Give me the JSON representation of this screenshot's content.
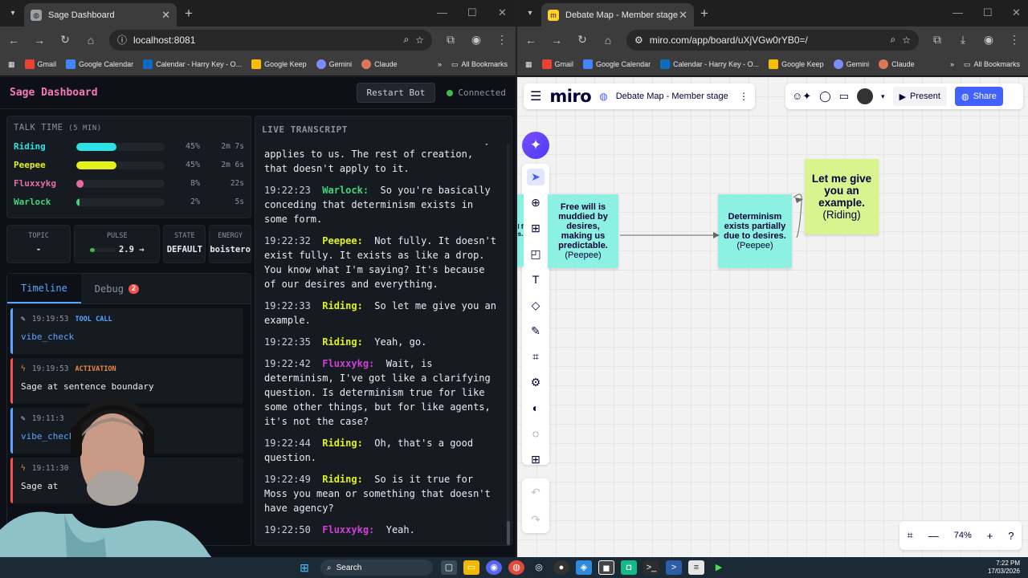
{
  "left_window": {
    "tab_title": "Sage Dashboard",
    "url": "localhost:8081",
    "bookmarks": [
      "Gmail",
      "Google Calendar",
      "Calendar - Harry Key - O...",
      "Google Keep",
      "Gemini",
      "Claude"
    ],
    "all_bookmarks": "All Bookmarks"
  },
  "right_window": {
    "tab_title": "Debate Map - Member stage - Miro",
    "url": "miro.com/app/board/uXjVGw0rYB0=/",
    "bookmarks": [
      "Gmail",
      "Google Calendar",
      "Calendar - Harry Key - O...",
      "Google Keep",
      "Gemini",
      "Claude"
    ],
    "all_bookmarks": "All Bookmarks"
  },
  "sage": {
    "title": "Sage Dashboard",
    "restart_label": "Restart Bot",
    "status": "Connected",
    "talk_time": {
      "heading": "TALK TIME",
      "window": "(5 MIN)",
      "rows": [
        {
          "name": "Riding",
          "pct": "45%",
          "time": "2m 7s",
          "fraction": 0.45,
          "color": "#2de2e6"
        },
        {
          "name": "Peepee",
          "pct": "45%",
          "time": "2m 6s",
          "fraction": 0.45,
          "color": "#e3f21c"
        },
        {
          "name": "Fluxxykg",
          "pct": "8%",
          "time": "22s",
          "fraction": 0.08,
          "color": "#e06fa0"
        },
        {
          "name": "Warlock",
          "pct": "2%",
          "time": "5s",
          "fraction": 0.02,
          "color": "#3fd67a"
        }
      ]
    },
    "stats": {
      "topic_label": "TOPIC",
      "topic_value": "-",
      "pulse_label": "PULSE",
      "pulse_value": "2.9 →",
      "state_label": "STATE",
      "state_value": "DEFAULT",
      "energy_label": "ENERGY",
      "energy_value": "boistero"
    },
    "tabs": {
      "timeline": "Timeline",
      "debug": "Debug",
      "debug_count": "2"
    },
    "events": [
      {
        "time": "19:19:53",
        "kind": "TOOL CALL",
        "body": "vibe_check",
        "type": "tool"
      },
      {
        "time": "19:19:53",
        "kind": "ACTIVATION",
        "body": "Sage at sentence boundary",
        "type": "act"
      },
      {
        "time": "19:11:3",
        "kind": "",
        "body": "vibe_check",
        "type": "tool"
      },
      {
        "time": "19:11:30",
        "kind": "",
        "body": "Sage at",
        "type": "act"
      }
    ],
    "transcript_heading": "LIVE TRANSCRIPT",
    "transcript_top": "to the universe itself. I think it only applies to us. The rest of creation, that doesn't apply to it.",
    "transcript": [
      {
        "time": "19:22:23",
        "speaker": "Warlock:",
        "text": "So you're basically conceding that determinism exists in some form.",
        "color": "#3fd67a"
      },
      {
        "time": "19:22:32",
        "speaker": "Peepee:",
        "text": "Not fully. It doesn't exist fully. It exists as like a drop. You know what I'm saying? It's because of our desires and everything.",
        "color": "#e3f21c"
      },
      {
        "time": "19:22:33",
        "speaker": "Riding:",
        "text": "So let me give you an example.",
        "color": "#e3f21c"
      },
      {
        "time": "19:22:35",
        "speaker": "Riding:",
        "text": "Yeah, go.",
        "color": "#e3f21c"
      },
      {
        "time": "19:22:42",
        "speaker": "Fluxxykg:",
        "text": "Wait, is determinism, I've got like a clarifying question. Is determinism true for like some other things, but for like agents, it's not the case?",
        "color": "#d23fd6"
      },
      {
        "time": "19:22:44",
        "speaker": "Riding:",
        "text": "Oh, that's a good question.",
        "color": "#e3f21c"
      },
      {
        "time": "19:22:49",
        "speaker": "Riding:",
        "text": "So is it true for Moss you mean or something that doesn't have agency?",
        "color": "#e3f21c"
      },
      {
        "time": "19:22:50",
        "speaker": "Fluxxykg:",
        "text": "Yeah.",
        "color": "#d23fd6"
      }
    ]
  },
  "miro": {
    "logo": "miro",
    "board_name": "Debate Map - Member stage",
    "present_label": "Present",
    "share_label": "Share",
    "zoom": "74%",
    "stickies": [
      {
        "text": "Free will is muddied by desires, making us predictable.",
        "author": "(Peepee)",
        "color": "#8cf0e2"
      },
      {
        "text": "Determinism exists partially due to desires.",
        "author": "(Peepee)",
        "color": "#8cf0e2"
      },
      {
        "text": "Let me give you an example.",
        "author": "(Riding)",
        "color": "#d8f48e"
      }
    ],
    "edge_sticky_text": "l f s."
  },
  "taskbar": {
    "search_label": "Search",
    "time": "7:22 PM",
    "date": "17/03/2026"
  }
}
